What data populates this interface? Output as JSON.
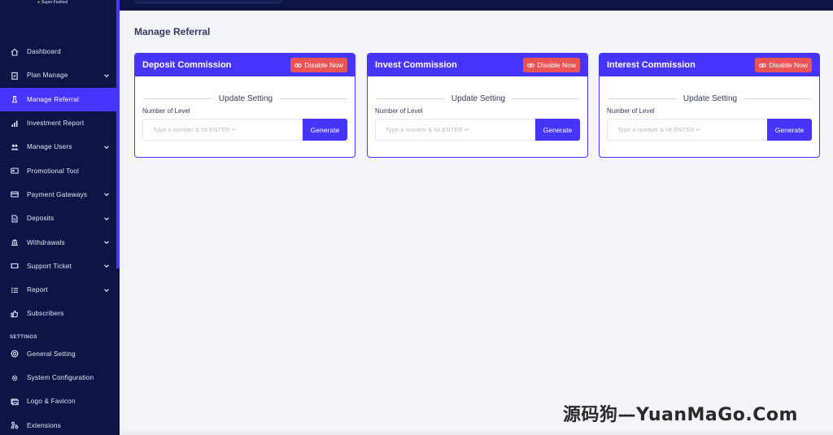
{
  "brand": {
    "tagline": "Super Festival"
  },
  "sidebar": {
    "items": [
      {
        "label": "Dashboard",
        "icon": "home-icon",
        "chevron": false,
        "active": false
      },
      {
        "label": "Plan Manage",
        "icon": "clipboard-icon",
        "chevron": true,
        "active": false
      },
      {
        "label": "Manage Referral",
        "icon": "user-icon",
        "chevron": false,
        "active": true
      },
      {
        "label": "Investment Report",
        "icon": "bar-chart-icon",
        "chevron": false,
        "active": false
      },
      {
        "label": "Manage Users",
        "icon": "users-icon",
        "chevron": true,
        "active": false
      },
      {
        "label": "Promotional Tool",
        "icon": "ad-icon",
        "chevron": false,
        "active": false
      },
      {
        "label": "Payment Gateways",
        "icon": "credit-card-icon",
        "chevron": true,
        "active": false
      },
      {
        "label": "Deposits",
        "icon": "file-invoice-icon",
        "chevron": true,
        "active": false
      },
      {
        "label": "Withdrawals",
        "icon": "bank-icon",
        "chevron": true,
        "active": false
      },
      {
        "label": "Support Ticket",
        "icon": "ticket-icon",
        "chevron": true,
        "active": false
      },
      {
        "label": "Report",
        "icon": "list-icon",
        "chevron": true,
        "active": false
      },
      {
        "label": "Subscribers",
        "icon": "thumbs-up-icon",
        "chevron": false,
        "active": false
      }
    ],
    "settings_title": "SETTINGS",
    "settings_items": [
      {
        "label": "General Setting",
        "icon": "life-ring-icon"
      },
      {
        "label": "System Configuration",
        "icon": "cog-icon"
      },
      {
        "label": "Logo & Favicon",
        "icon": "images-icon"
      },
      {
        "label": "Extensions",
        "icon": "sitemap-icon"
      }
    ]
  },
  "page": {
    "title": "Manage Referral"
  },
  "cards": [
    {
      "title": "Deposit Commission",
      "disable_label": "Disable Now",
      "update_label": "Update Setting",
      "level_label": "Number of Level",
      "placeholder": "Type a number & hit ENTER ↵",
      "generate_label": "Generate"
    },
    {
      "title": "Invest Commission",
      "disable_label": "Disable Now",
      "update_label": "Update Setting",
      "level_label": "Number of Level",
      "placeholder": "Type a number & hit ENTER ↵",
      "generate_label": "Generate"
    },
    {
      "title": "Interest Commission",
      "disable_label": "Disable Now",
      "update_label": "Update Setting",
      "level_label": "Number of Level",
      "placeholder": "Type a number & hit ENTER ↵",
      "generate_label": "Generate"
    }
  ],
  "watermark": "源码狗—YuanMaGo.Com",
  "colors": {
    "sidebar_bg": "#0c1546",
    "primary": "#4634ff",
    "danger": "#ea5455",
    "page_bg": "#f3f4f8"
  }
}
